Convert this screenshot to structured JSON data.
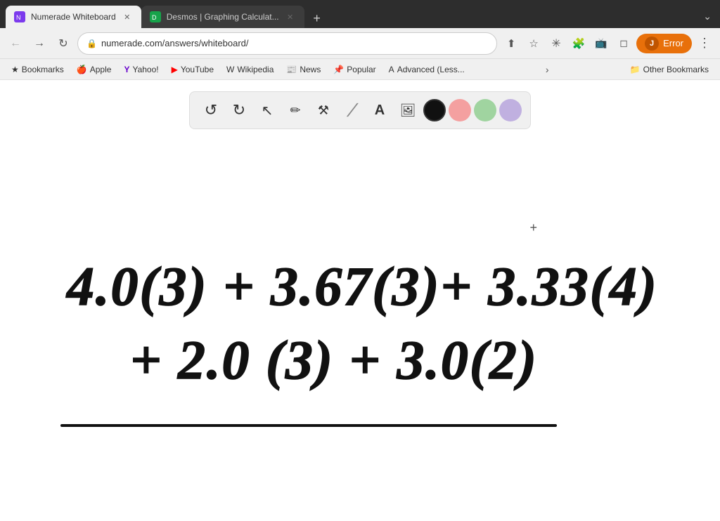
{
  "browser": {
    "tabs": [
      {
        "id": "tab1",
        "favicon": "N",
        "favicon_color": "#7c3aed",
        "title": "Numerade Whiteboard",
        "active": true
      },
      {
        "id": "tab2",
        "favicon": "D",
        "favicon_color": "#16a34a",
        "title": "Desmos | Graphing Calculat...",
        "active": false
      }
    ],
    "address": "numerade.com/answers/whiteboard/",
    "profile_label": "Error",
    "profile_initial": "J"
  },
  "bookmarks": [
    {
      "id": "bk1",
      "icon": "★",
      "label": "Bookmarks"
    },
    {
      "id": "bk2",
      "icon": "🍎",
      "label": "Apple"
    },
    {
      "id": "bk3",
      "icon": "Y",
      "label": "Yahoo!"
    },
    {
      "id": "bk4",
      "icon": "▶",
      "label": "YouTube"
    },
    {
      "id": "bk5",
      "icon": "W",
      "label": "Wikipedia"
    },
    {
      "id": "bk6",
      "icon": "📰",
      "label": "News"
    },
    {
      "id": "bk7",
      "icon": "📌",
      "label": "Popular"
    },
    {
      "id": "bk8",
      "icon": "A",
      "label": "Advanced (Less..."
    }
  ],
  "other_bookmarks_label": "Other Bookmarks",
  "toolbar": {
    "tools": [
      {
        "id": "undo",
        "symbol": "↺",
        "label": "Undo"
      },
      {
        "id": "redo",
        "symbol": "↻",
        "label": "Redo"
      },
      {
        "id": "select",
        "symbol": "↖",
        "label": "Select"
      },
      {
        "id": "pencil",
        "symbol": "✏",
        "label": "Pencil"
      },
      {
        "id": "tools",
        "symbol": "⚙",
        "label": "Tools"
      },
      {
        "id": "marker",
        "symbol": "━",
        "label": "Marker"
      },
      {
        "id": "text",
        "symbol": "A",
        "label": "Text"
      },
      {
        "id": "image",
        "symbol": "🖼",
        "label": "Image"
      }
    ],
    "colors": [
      {
        "id": "black",
        "hex": "#111111",
        "selected": true
      },
      {
        "id": "pink",
        "hex": "#f4a0a0"
      },
      {
        "id": "green",
        "hex": "#a0d4a0"
      },
      {
        "id": "lavender",
        "hex": "#c0b0e0"
      }
    ]
  },
  "canvas": {
    "plus_cursor": "+",
    "math_line1": "4.0(3) + 3.67(3)+ 3.33(4)",
    "math_line2": "+ 2.0 (3) + 3.0(2)"
  }
}
